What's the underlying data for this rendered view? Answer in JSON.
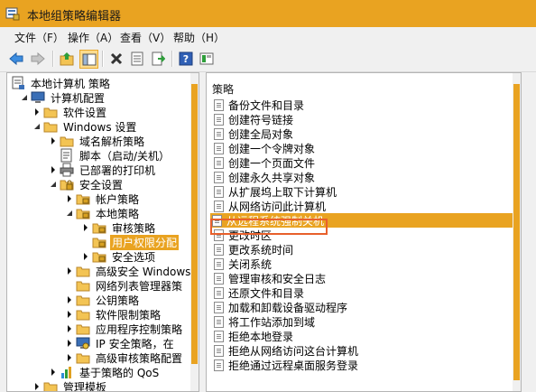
{
  "window": {
    "title": "本地组策略编辑器"
  },
  "menu": [
    "文件（F）",
    "操作（A）",
    "查看（V）",
    "帮助（H）"
  ],
  "toolbar_icons": [
    "back-arrow-icon",
    "forward-arrow-icon",
    "up-folder-icon",
    "show-hide-tree-icon",
    "delete-icon",
    "properties-icon",
    "export-list-icon",
    "help-icon",
    "view-icon"
  ],
  "tree": [
    {
      "label": "本地计算机 策略",
      "icon": "computer-policy-icon",
      "expander": "none",
      "level": 0
    },
    {
      "label": "计算机配置",
      "icon": "computer-icon",
      "expander": "open",
      "level": 1
    },
    {
      "label": "软件设置",
      "icon": "folder-icon",
      "expander": "closed",
      "level": 2
    },
    {
      "label": "Windows 设置",
      "icon": "folder-icon",
      "expander": "open",
      "level": 2
    },
    {
      "label": "域名解析策略",
      "icon": "folder-icon",
      "expander": "closed",
      "level": 3
    },
    {
      "label": "脚本（启动/关机）",
      "icon": "script-icon",
      "expander": "none",
      "level": 3
    },
    {
      "label": "已部署的打印机",
      "icon": "printer-icon",
      "expander": "closed",
      "level": 3
    },
    {
      "label": "安全设置",
      "icon": "security-icon",
      "expander": "open",
      "level": 3
    },
    {
      "label": "帐户策略",
      "icon": "folder-icon",
      "expander": "closed",
      "level": 4
    },
    {
      "label": "本地策略",
      "icon": "folder-icon",
      "expander": "open",
      "level": 4
    },
    {
      "label": "审核策略",
      "icon": "folder-icon",
      "expander": "closed",
      "level": 5
    },
    {
      "label": "用户权限分配",
      "icon": "folder-icon",
      "expander": "none",
      "level": 5,
      "selected": true
    },
    {
      "label": "安全选项",
      "icon": "folder-icon",
      "expander": "closed",
      "level": 5
    },
    {
      "label": "高级安全 Windows",
      "icon": "folder-icon",
      "expander": "closed",
      "level": 4
    },
    {
      "label": "网络列表管理器策",
      "icon": "folder-icon",
      "expander": "none",
      "level": 4
    },
    {
      "label": "公钥策略",
      "icon": "folder-icon",
      "expander": "closed",
      "level": 4
    },
    {
      "label": "软件限制策略",
      "icon": "folder-icon",
      "expander": "closed",
      "level": 4
    },
    {
      "label": "应用程序控制策略",
      "icon": "folder-icon",
      "expander": "closed",
      "level": 4
    },
    {
      "label": "IP 安全策略，在 ",
      "icon": "ip-security-icon",
      "expander": "closed",
      "level": 4
    },
    {
      "label": "高级审核策略配置",
      "icon": "folder-icon",
      "expander": "closed",
      "level": 4
    },
    {
      "label": "基于策略的 QoS",
      "icon": "qos-chart-icon",
      "expander": "closed",
      "level": 3
    },
    {
      "label": "管理模板",
      "icon": "folder-icon",
      "expander": "closed",
      "level": 2
    }
  ],
  "list": {
    "header": "策略",
    "items": [
      "备份文件和目录",
      "创建符号链接",
      "创建全局对象",
      "创建一个令牌对象",
      "创建一个页面文件",
      "创建永久共享对象",
      "从扩展坞上取下计算机",
      "从网络访问此计算机",
      "从远程系统强制关机",
      "更改时区",
      "更改系统时间",
      "关闭系统",
      "管理审核和安全日志",
      "还原文件和目录",
      "加载和卸载设备驱动程序",
      "将工作站添加到域",
      "拒绝本地登录",
      "拒绝从网络访问这台计算机",
      "拒绝通过远程桌面服务登录"
    ],
    "selected_index": 8
  },
  "colors": {
    "accent": "#e9a321",
    "highlight_outline": "#e8602c"
  }
}
